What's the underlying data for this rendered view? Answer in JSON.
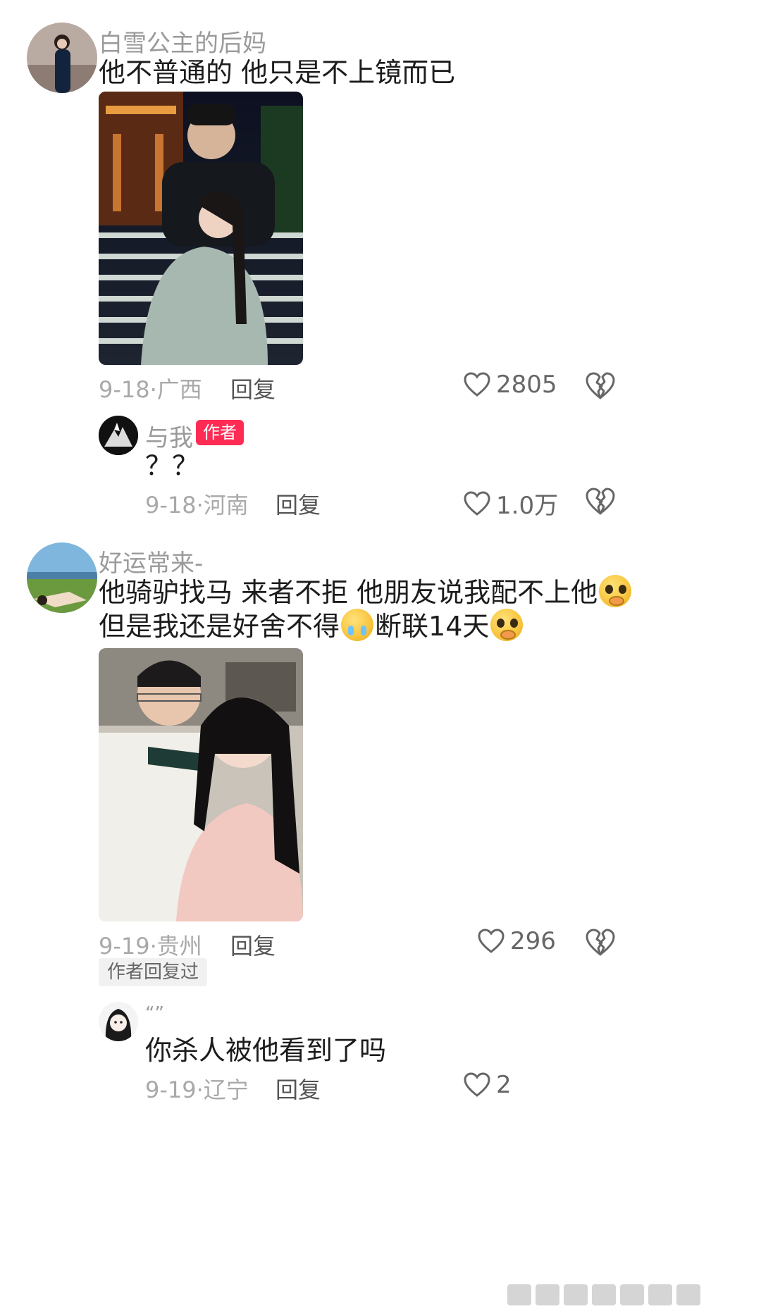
{
  "comments": [
    {
      "username": "白雪公主的后妈",
      "text_lines": [
        "他不普通的 他只是不上镜而已"
      ],
      "date": "9-18",
      "location": "广西",
      "reply_label": "回复",
      "likes": "2805",
      "avatar": "avatar-woman-dark-dress",
      "photo": "photo-couple-night-steps"
    },
    {
      "username": "与我",
      "badge": "作者",
      "text_lines": [
        "？？"
      ],
      "date": "9-18",
      "location": "河南",
      "reply_label": "回复",
      "likes": "1.0万",
      "avatar": "avatar-dark-mountain"
    },
    {
      "username": "好运常来-",
      "text_line1": "他骑驴找马 来者不拒 他朋友说我配不上他",
      "text_line2a": "但是我还是好舍不得",
      "text_line2b": "断联14天",
      "emojis": [
        "pleading-face",
        "loudly-crying-face",
        "pleading-face"
      ],
      "date": "9-19",
      "location": "贵州",
      "reply_label": "回复",
      "likes": "296",
      "author_replied_tag": "作者回复过",
      "avatar": "avatar-woman-lying-on-grass",
      "photo": "photo-couple-selfie-restaurant"
    },
    {
      "username": "“”",
      "text_lines": [
        "你杀人被他看到了吗"
      ],
      "date": "9-19",
      "location": "辽宁",
      "reply_label": "回复",
      "likes": "2",
      "avatar": "avatar-anime-girl"
    }
  ],
  "separator": "·",
  "colors": {
    "badge": "#fe2c55",
    "meta_text": "#a9a9a9",
    "username": "#9a9a9a",
    "body_text": "#1c1c1c"
  },
  "icons": [
    "heart-outline-icon",
    "broken-heart-icon"
  ]
}
